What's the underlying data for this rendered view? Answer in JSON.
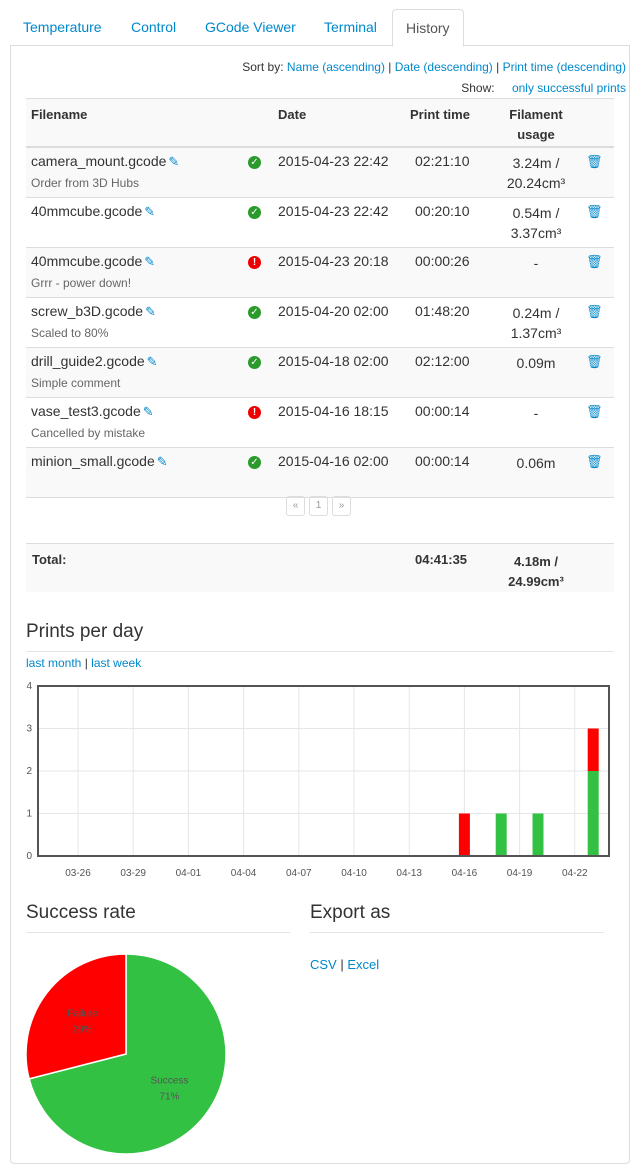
{
  "tabs": [
    {
      "label": "Temperature",
      "active": false
    },
    {
      "label": "Control",
      "active": false
    },
    {
      "label": "GCode Viewer",
      "active": false
    },
    {
      "label": "Terminal",
      "active": false
    },
    {
      "label": "History",
      "active": true
    }
  ],
  "sort": {
    "label": "Sort by:",
    "name": "Name (ascending)",
    "date": "Date (descending)",
    "printtime": "Print time (descending)"
  },
  "show": {
    "label": "Show:",
    "filter": "only successful prints"
  },
  "table": {
    "headers": {
      "filename": "Filename",
      "date": "Date",
      "printtime": "Print time",
      "filament1": "Filament",
      "filament2": "usage"
    },
    "rows": [
      {
        "file": "camera_mount.gcode",
        "comment": "Order from 3D Hubs",
        "success": true,
        "date": "2015-04-23 22:42",
        "time": "02:21:10",
        "fil1": "3.24m /",
        "fil2": "20.24cm³"
      },
      {
        "file": "40mmcube.gcode",
        "comment": "",
        "success": true,
        "date": "2015-04-23 22:42",
        "time": "00:20:10",
        "fil1": "0.54m /",
        "fil2": "3.37cm³"
      },
      {
        "file": "40mmcube.gcode",
        "comment": "Grrr - power down!",
        "success": false,
        "date": "2015-04-23 20:18",
        "time": "00:00:26",
        "fil1": "-",
        "fil2": ""
      },
      {
        "file": "screw_b3D.gcode",
        "comment": "Scaled to 80%",
        "success": true,
        "date": "2015-04-20 02:00",
        "time": "01:48:20",
        "fil1": "0.24m /",
        "fil2": "1.37cm³"
      },
      {
        "file": "drill_guide2.gcode",
        "comment": "Simple comment",
        "success": true,
        "date": "2015-04-18 02:00",
        "time": "02:12:00",
        "fil1": "0.09m",
        "fil2": ""
      },
      {
        "file": "vase_test3.gcode",
        "comment": "Cancelled by mistake",
        "success": false,
        "date": "2015-04-16 18:15",
        "time": "00:00:14",
        "fil1": "-",
        "fil2": ""
      },
      {
        "file": "minion_small.gcode",
        "comment": "",
        "success": true,
        "date": "2015-04-16 02:00",
        "time": "00:00:14",
        "fil1": "0.06m",
        "fil2": ""
      }
    ]
  },
  "pager": {
    "prev": "«",
    "page": "1",
    "next": "»"
  },
  "total": {
    "label": "Total:",
    "time": "04:41:35",
    "fil1": "4.18m /",
    "fil2": "24.99cm³"
  },
  "prints_per_day": {
    "title": "Prints per day",
    "link_month": "last month",
    "link_week": "last week",
    "separator": "|"
  },
  "success_rate": {
    "title": "Success rate"
  },
  "export": {
    "title": "Export as",
    "csv": "CSV",
    "excel": "Excel",
    "separator": "|"
  },
  "colors": {
    "success": "#33c143",
    "failure": "#ff0000",
    "link": "#0088cc"
  },
  "chart_data": [
    {
      "type": "bar",
      "stacked": true,
      "x_ticks": [
        "03-26",
        "03-29",
        "04-01",
        "04-04",
        "04-07",
        "04-10",
        "04-13",
        "04-16",
        "04-19",
        "04-22"
      ],
      "y_ticks": [
        "0",
        "1",
        "2",
        "3",
        "4"
      ],
      "ylim": [
        0,
        4
      ],
      "grid": true,
      "categories": [
        "04-16",
        "04-18",
        "04-20",
        "04-23"
      ],
      "series": [
        {
          "values": [
            0,
            1,
            1,
            2
          ],
          "color": "#33c143"
        },
        {
          "values": [
            1,
            0,
            0,
            1
          ],
          "color": "#ff0000"
        }
      ]
    },
    {
      "type": "pie",
      "slices": [
        {
          "label": "Success",
          "pct_label": "71%",
          "value": 71,
          "color": "#33c143"
        },
        {
          "label": "Failure",
          "pct_label": "29%",
          "value": 29,
          "color": "#ff0000"
        }
      ]
    }
  ]
}
